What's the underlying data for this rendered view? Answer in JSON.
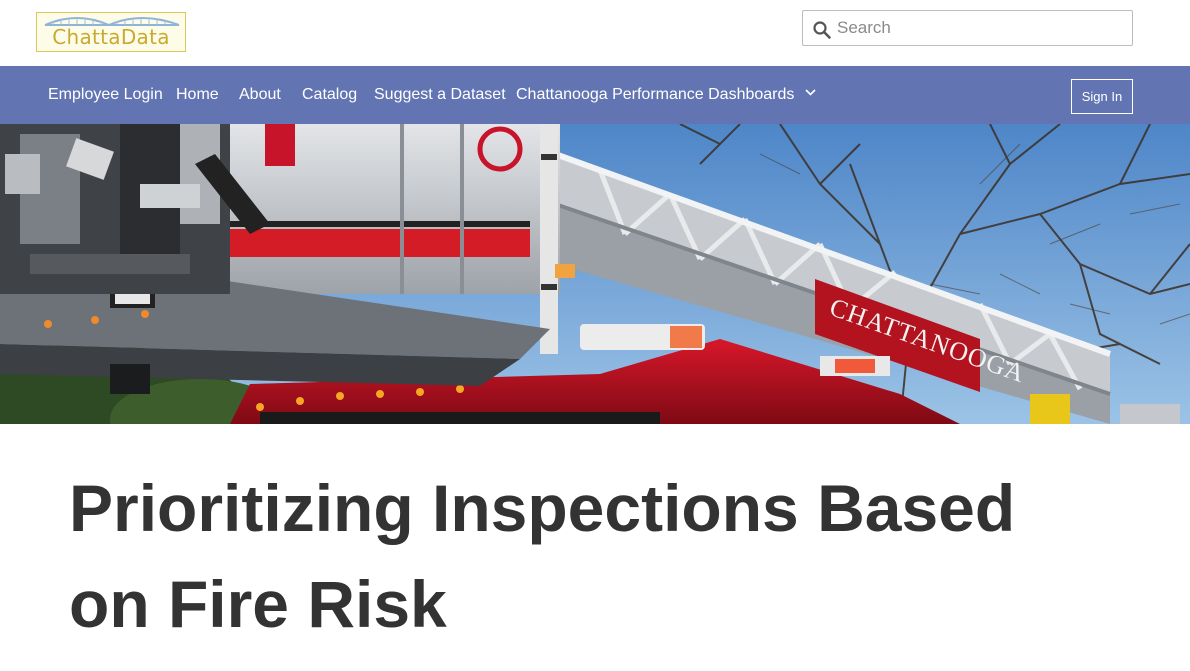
{
  "header": {
    "logo_text": "ChattaData",
    "search": {
      "placeholder": "Search",
      "value": ""
    }
  },
  "nav": {
    "items": [
      {
        "label": "Employee Login"
      },
      {
        "label": "Home"
      },
      {
        "label": "About"
      },
      {
        "label": "Catalog"
      },
      {
        "label": "Suggest a Dataset"
      },
      {
        "label": "Chattanooga Performance Dashboards"
      }
    ],
    "sign_in_label": "Sign In"
  },
  "hero": {
    "truck_lettering": "CHATTANOOGA",
    "description": "Chattanooga fire truck ladder"
  },
  "page": {
    "title": "Prioritizing Inspections Based on Fire Risk"
  },
  "colors": {
    "nav_background": "#6275b2",
    "logo_gold": "#c8aa2e",
    "title_text": "#333333"
  },
  "icons": {
    "search": "search-icon",
    "dropdown": "chevron-down-icon"
  }
}
